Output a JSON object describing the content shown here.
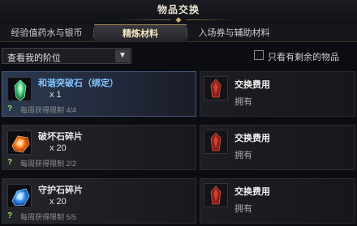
{
  "window": {
    "title": "物品交换"
  },
  "tabs": [
    {
      "label": "经验值药水与银币"
    },
    {
      "label": "精炼材料"
    },
    {
      "label": "入场券与辅助材料"
    }
  ],
  "filter": {
    "dropdown_value": "查看我的阶位",
    "checkbox_label": "只看有剩余的物品",
    "checkbox_checked": false
  },
  "items": [
    {
      "name": "和谐突破石（绑定）",
      "quantity": "x 1",
      "weekly_limit": "每周获得限制 4/4",
      "cost_label": "交换费用",
      "owned_label": "拥有",
      "icon": "green-crystal-icon"
    },
    {
      "name": "破坏石碎片",
      "quantity": "x 20",
      "weekly_limit": "每周获得限制 2/2",
      "cost_label": "交换费用",
      "owned_label": "拥有",
      "icon": "fire-shard-icon"
    },
    {
      "name": "守护石碎片",
      "quantity": "x 20",
      "weekly_limit": "每周获得限制 5/5",
      "cost_label": "交换费用",
      "owned_label": "拥有",
      "icon": "blue-shard-icon"
    }
  ],
  "colors": {
    "accent_gold": "#c9b27a",
    "selected_name": "#7fc4ff",
    "help_green": "#9ae26a"
  }
}
